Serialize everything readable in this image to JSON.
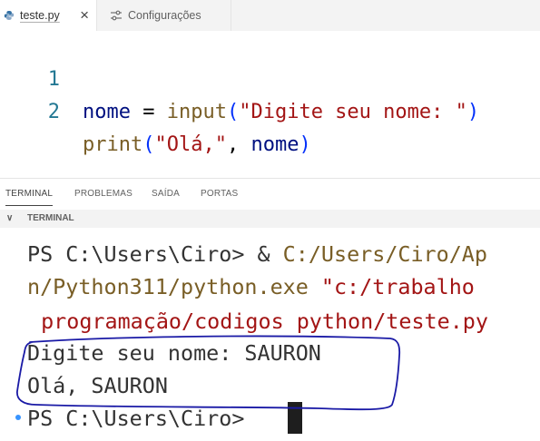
{
  "tabs": [
    {
      "label": "teste.py",
      "close": "×"
    },
    {
      "label": "Configurações"
    }
  ],
  "editor": {
    "lines": [
      {
        "number": "1",
        "tokens": [
          "nome",
          " = ",
          "input",
          "(",
          "\"Digite seu nome: \"",
          ")"
        ]
      },
      {
        "number": "2",
        "tokens": [
          "print",
          "(",
          "\"Olá,\"",
          ", ",
          "nome",
          ")"
        ]
      }
    ]
  },
  "panel": {
    "tabs": [
      "TERMINAL",
      "PROBLEMAS",
      "SAÍDA",
      "PORTAS"
    ],
    "active_tab": "TERMINAL",
    "section_title": "TERMINAL",
    "section_chevron": "∨"
  },
  "terminal": {
    "line1_prompt": "PS C:\\Users\\Ciro> & ",
    "line1_path": "C:/Users/Ciro/Ap",
    "line2_path": "n/Python311/python.exe",
    "line2_str": " \"c:/trabalho",
    "line3_str": " programação/codigos python/teste.py",
    "line4": "Digite seu nome: SAURON",
    "line5": "Olá, SAURON",
    "line6": "PS C:\\Users\\Ciro> "
  },
  "colors": {
    "accent_blue": "#0431fa",
    "annotation_ink": "#1a1aa6",
    "string_red": "#a31515",
    "function_brown": "#795e26"
  }
}
